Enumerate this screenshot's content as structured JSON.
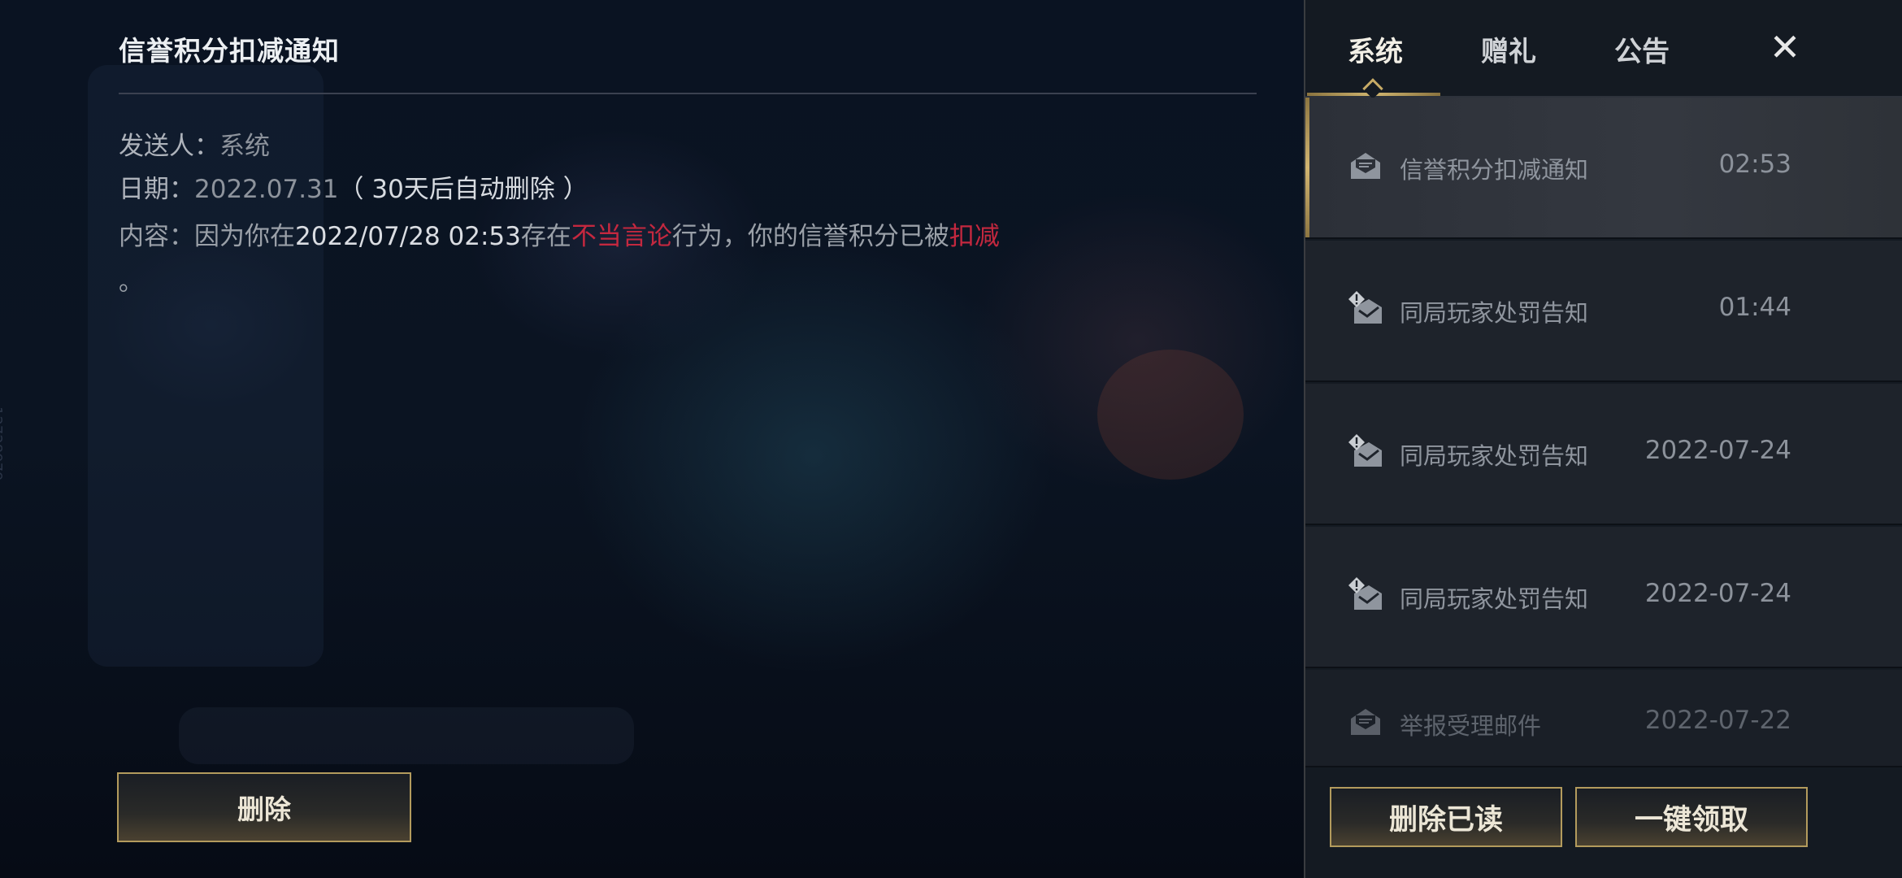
{
  "side_id": "12728979",
  "detail": {
    "title": "信誉积分扣减通知",
    "sender_label": "发送人：",
    "sender": "系统",
    "date_label": "日期：",
    "date": "2022.07.31",
    "date_note": "（ 30天后自动删除 ）",
    "content_label": "内容：",
    "content_parts": [
      "因为你在",
      "2022/07/28 02:53",
      "存在",
      "不当言论",
      "行为，你的信誉积分已被",
      "扣减"
    ],
    "content_end": "。",
    "delete_button": "删除"
  },
  "panel": {
    "tabs": [
      {
        "label": "系统",
        "active": true
      },
      {
        "label": "赠礼",
        "active": false
      },
      {
        "label": "公告",
        "active": false
      }
    ],
    "close_label": "✕",
    "mails": [
      {
        "title": "信誉积分扣减通知",
        "time": "02:53",
        "icon": "open-mail-icon",
        "selected": true
      },
      {
        "title": "同局玩家处罚告知",
        "time": "01:44",
        "icon": "alert-mail-icon",
        "selected": false
      },
      {
        "title": "同局玩家处罚告知",
        "time": "2022-07-24",
        "icon": "alert-mail-icon",
        "selected": false
      },
      {
        "title": "同局玩家处罚告知",
        "time": "2022-07-24",
        "icon": "alert-mail-icon",
        "selected": false
      },
      {
        "title": "举报受理邮件",
        "time": "2022-07-22",
        "icon": "open-mail-icon",
        "selected": false
      }
    ],
    "delete_read_button": "删除已读",
    "claim_all_button": "一键领取"
  },
  "colors": {
    "accent_gold": "#b39b5d",
    "highlight_red": "#c4283f"
  }
}
